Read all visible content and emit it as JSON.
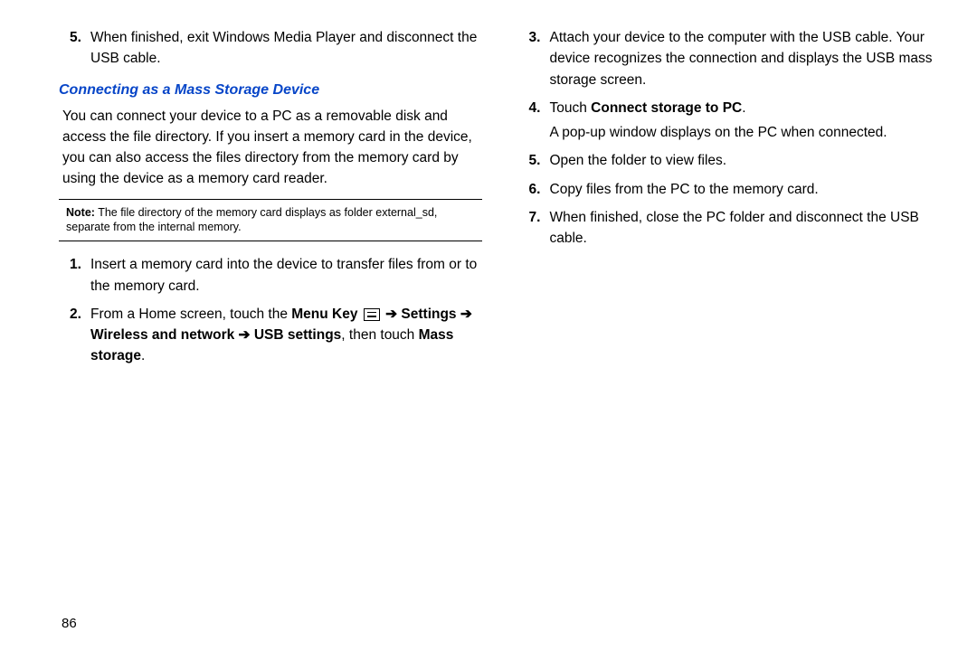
{
  "leftCol": {
    "topItem": {
      "num": "5.",
      "text": "When finished, exit Windows Media Player and disconnect the USB cable."
    },
    "heading": "Connecting as a Mass Storage Device",
    "intro": "You can connect your device to a PC as a removable disk and access the file directory. If you insert a memory card in the device, you can also access the files directory from the memory card by using the device as a memory card reader.",
    "noteLabel": "Note:",
    "noteText": " The file directory of the memory card displays as folder external_sd, separate from the internal memory.",
    "item1": {
      "num": "1.",
      "text": "Insert a memory card into the device to transfer files from or to the memory card."
    },
    "item2": {
      "num": "2.",
      "prefix": "From a Home screen, touch the ",
      "menuKey": "Menu Key",
      "arrow1": " ➔ ",
      "settings": "Settings",
      "arrow2": " ➔ ",
      "wireless": "Wireless and network",
      "arrow3": " ➔ ",
      "usb": "USB settings",
      "then": ", then touch ",
      "mass": "Mass storage",
      "period": "."
    }
  },
  "rightCol": {
    "item3": {
      "num": "3.",
      "text": "Attach your device to the computer with the USB cable. Your device recognizes the connection and displays the USB mass storage screen."
    },
    "item4": {
      "num": "4.",
      "prefix": "Touch ",
      "bold": "Connect storage to PC",
      "period": ".",
      "line2": "A pop-up window displays on the PC when connected."
    },
    "item5": {
      "num": "5.",
      "text": "Open the folder to view files."
    },
    "item6": {
      "num": "6.",
      "text": "Copy files from the PC to the memory card."
    },
    "item7": {
      "num": "7.",
      "text": "When finished, close the PC folder and disconnect the USB cable."
    }
  },
  "pageNum": "86"
}
